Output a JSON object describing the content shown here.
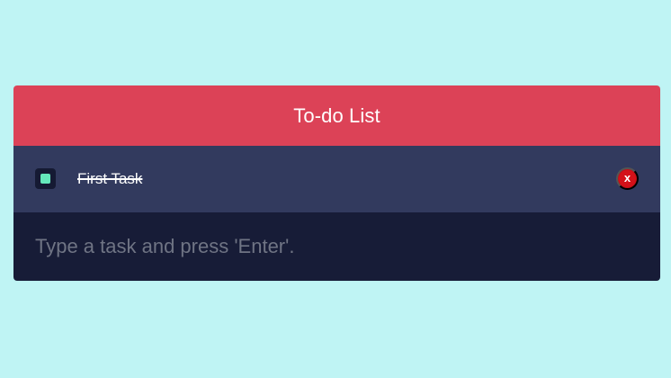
{
  "todo": {
    "title": "To-do List",
    "tasks": [
      {
        "label": "First Task",
        "completed": true
      }
    ],
    "delete_label": "x",
    "input": {
      "placeholder": "Type a task and press 'Enter'.",
      "value": ""
    }
  },
  "colors": {
    "background": "#bff4f4",
    "header": "#dc4257",
    "task_row": "#323a5e",
    "input_row": "#171c37",
    "checkbox_fill": "#65e8bb",
    "delete_button": "#d41119"
  },
  "icons": {
    "checkbox": "checked-checkbox-icon",
    "delete": "close-icon"
  }
}
